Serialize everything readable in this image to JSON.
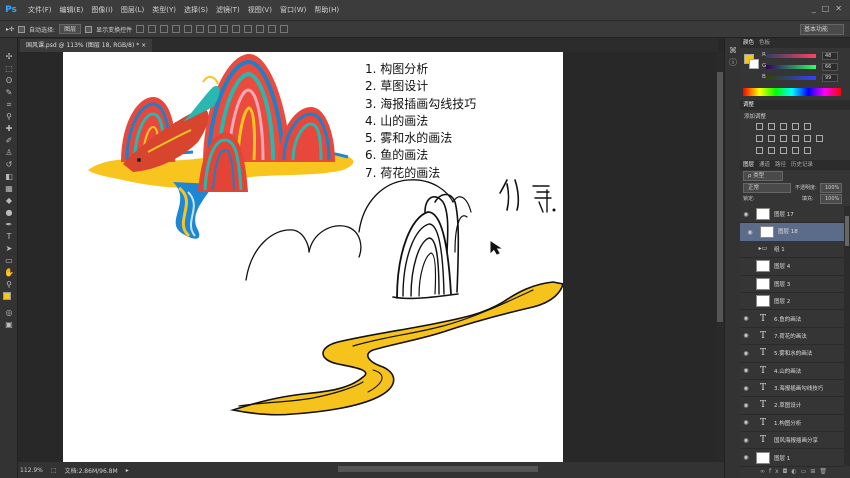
{
  "app": {
    "logo": "Ps"
  },
  "menu": [
    "文件(F)",
    "编辑(E)",
    "图像(I)",
    "图层(L)",
    "类型(Y)",
    "选择(S)",
    "滤镜(T)",
    "视图(V)",
    "窗口(W)",
    "帮助(H)"
  ],
  "window_controls": [
    "_",
    "□",
    "✕"
  ],
  "options": {
    "auto_select_label": "自动选择:",
    "auto_select_value": "图层",
    "show_transform_label": "显示变换控件",
    "workspace": "基本功能"
  },
  "document": {
    "tab_title": "国风课.psd @ 113% (图层 18, RGB/8) * ×",
    "outline": [
      "1. 构图分析",
      "2. 草图设计",
      "3. 海报插画勾线技巧",
      "4. 山的画法",
      "5. 雾和水的画法",
      "6. 鱼的画法",
      "7. 荷花的画法"
    ]
  },
  "status": {
    "zoom": "112.9%",
    "docsize": "文档:2.86M/96.8M"
  },
  "panels": {
    "color_tabs": [
      "颜色",
      "色板"
    ],
    "rgb": [
      {
        "label": "R",
        "value": "48"
      },
      {
        "label": "G",
        "value": "66"
      },
      {
        "label": "B",
        "value": "99"
      }
    ],
    "adjust_tab": "调整",
    "adjust_add": "添加调整",
    "layers_tabs": [
      "图层",
      "通道",
      "路径",
      "历史记录"
    ],
    "kind": "ρ 类型",
    "blend_mode": "正常",
    "opacity_label": "不透明度:",
    "opacity": "100%",
    "lock_label": "锁定:",
    "fill_label": "填充:",
    "fill": "100%"
  },
  "layers": [
    {
      "type": "image",
      "name": "图层 17",
      "visible": true,
      "selected": false
    },
    {
      "type": "image",
      "name": "图层 18",
      "visible": true,
      "selected": true
    },
    {
      "type": "group",
      "name": "组 1",
      "visible": false,
      "selected": false
    },
    {
      "type": "image",
      "name": "图层 4",
      "visible": false,
      "selected": false
    },
    {
      "type": "image",
      "name": "图层 3",
      "visible": false,
      "selected": false
    },
    {
      "type": "image",
      "name": "图层 2",
      "visible": false,
      "selected": false
    },
    {
      "type": "text",
      "name": "6.鱼的画法",
      "visible": true,
      "selected": false
    },
    {
      "type": "text",
      "name": "7.荷花的画法",
      "visible": true,
      "selected": false
    },
    {
      "type": "text",
      "name": "5.雾和水的画法",
      "visible": true,
      "selected": false
    },
    {
      "type": "text",
      "name": "4.山的画法",
      "visible": true,
      "selected": false
    },
    {
      "type": "text",
      "name": "3.海报插画勾线技巧",
      "visible": true,
      "selected": false
    },
    {
      "type": "text",
      "name": "2.草图设计",
      "visible": true,
      "selected": false
    },
    {
      "type": "text",
      "name": "1.构图分析",
      "visible": true,
      "selected": false
    },
    {
      "type": "text",
      "name": "国风海报插画分享",
      "visible": true,
      "selected": false
    },
    {
      "type": "image",
      "name": "图层 1",
      "visible": true,
      "selected": false
    }
  ]
}
